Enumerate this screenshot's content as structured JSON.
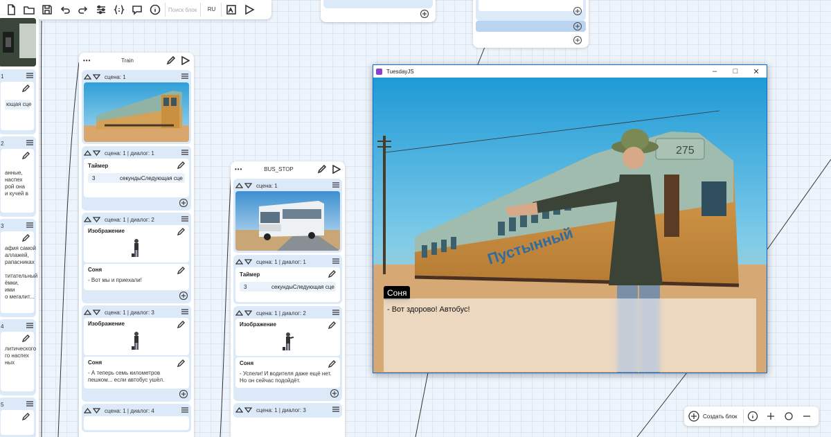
{
  "toolbar": {
    "search_placeholder": "Поиск блок",
    "language": "RU"
  },
  "columns": {
    "train": {
      "title": "Train",
      "cards": [
        {
          "label": "сцена: 1"
        },
        {
          "label": "сцена: 1 | диалог: 1",
          "title": "Таймер",
          "seconds": "3",
          "timer_text": "секундыСледующая сце"
        },
        {
          "label": "сцена: 1 | диалог: 2",
          "title": "Изображение",
          "speaker": "Соня",
          "text": "- Вот мы и приехали!"
        },
        {
          "label": "сцена: 1 | диалог: 3",
          "title": "Изображение",
          "speaker": "Соня",
          "text": "- А теперь семь километров пешком... если автобус ушёл."
        },
        {
          "label": "сцена: 1 | диалог: 4"
        }
      ]
    },
    "bus_stop": {
      "title": "BUS_STOP",
      "cards": [
        {
          "label": "сцена: 1"
        },
        {
          "label": "сцена: 1 | диалог: 1",
          "title": "Таймер",
          "seconds": "3",
          "timer_text": "секундыСледующая сце"
        },
        {
          "label": "сцена: 1 | диалог: 2",
          "title": "Изображение",
          "speaker": "Соня",
          "text": "- Успели! И водителя даже ещё нет. Но он сейчас подойдёт."
        },
        {
          "label": "сцена: 1 | диалог: 3"
        }
      ]
    },
    "left": {
      "numbers": [
        "1",
        "2",
        "3",
        "4",
        "5"
      ],
      "snippets": [
        "ющая сце",
        "анные,\nнаспех\nрой она\nи кучей в",
        "афия самой\nаллажей,\nрапасниках\n\nтитательный\nёмки,\nими\nо мегалит...",
        "литического\nго наспех\nных"
      ]
    }
  },
  "game": {
    "window_title": "TuesdayJS",
    "speaker": "Соня",
    "dialog": "- Вот здорово! Автобус!",
    "tram_number": "275",
    "tram_sign": "Пустынный"
  },
  "bottombar": {
    "create_label": "Создать блок"
  }
}
